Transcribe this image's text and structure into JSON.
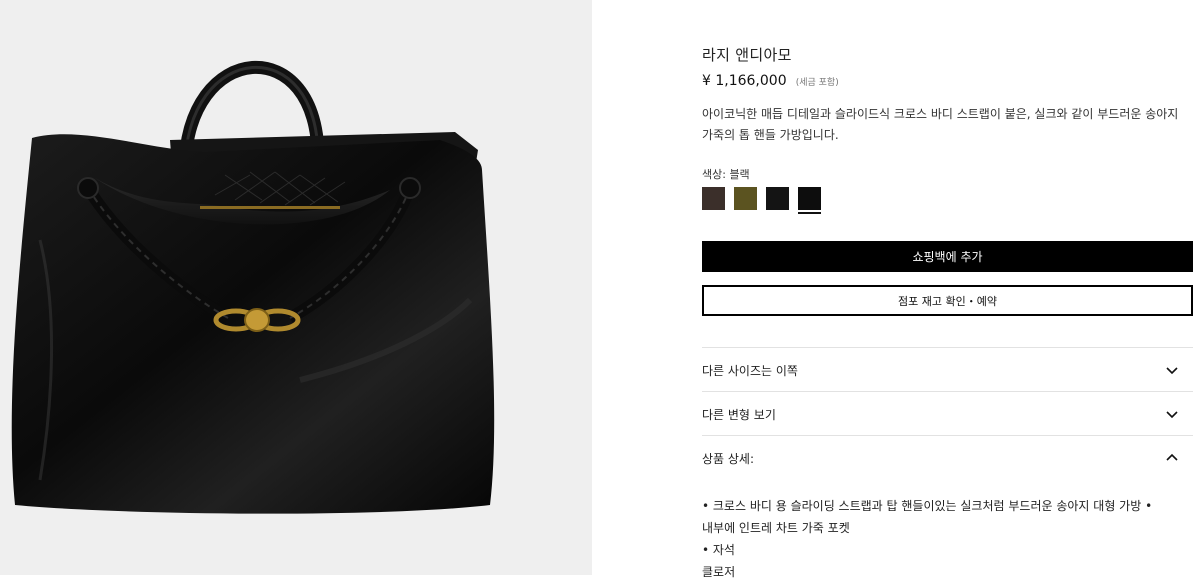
{
  "product": {
    "name": "라지 앤디아모",
    "price": "¥ 1,166,000",
    "tax_note": "(세금 포함)",
    "description": "아이코닉한 매듭 디테일과 슬라이드식 크로스 바디 스트랩이 붙은, 실크와 같이 부드러운 송아지 가죽의 톱 핸들 가방입니다."
  },
  "color": {
    "label": "색상: 블랙",
    "swatches": [
      {
        "name": "dark-brown",
        "hex": "#3b2f2a"
      },
      {
        "name": "olive",
        "hex": "#5b5320"
      },
      {
        "name": "black",
        "hex": "#141414"
      },
      {
        "name": "black-selected",
        "hex": "#0d0d0d"
      }
    ],
    "selected_index": 3
  },
  "actions": {
    "add_to_bag": "쇼핑백에 추가",
    "store_check": "점포 재고 확인・예약"
  },
  "accordion": [
    {
      "label": "다른 사이즈는 이쪽",
      "icon": "chevron-down-icon"
    },
    {
      "label": "다른 변형 보기",
      "icon": "chevron-down-icon"
    },
    {
      "label": "상품 상세:",
      "icon": "chevron-up-icon"
    }
  ],
  "details": [
    "• 크로스 바디 용 슬라이딩 스트랩과 탑 핸들이있는 실크처럼 부드러운 송아지 대형 가방 •",
    "내부에 인트레 차트 가죽 포켓",
    "• 자석",
    "클로저"
  ]
}
